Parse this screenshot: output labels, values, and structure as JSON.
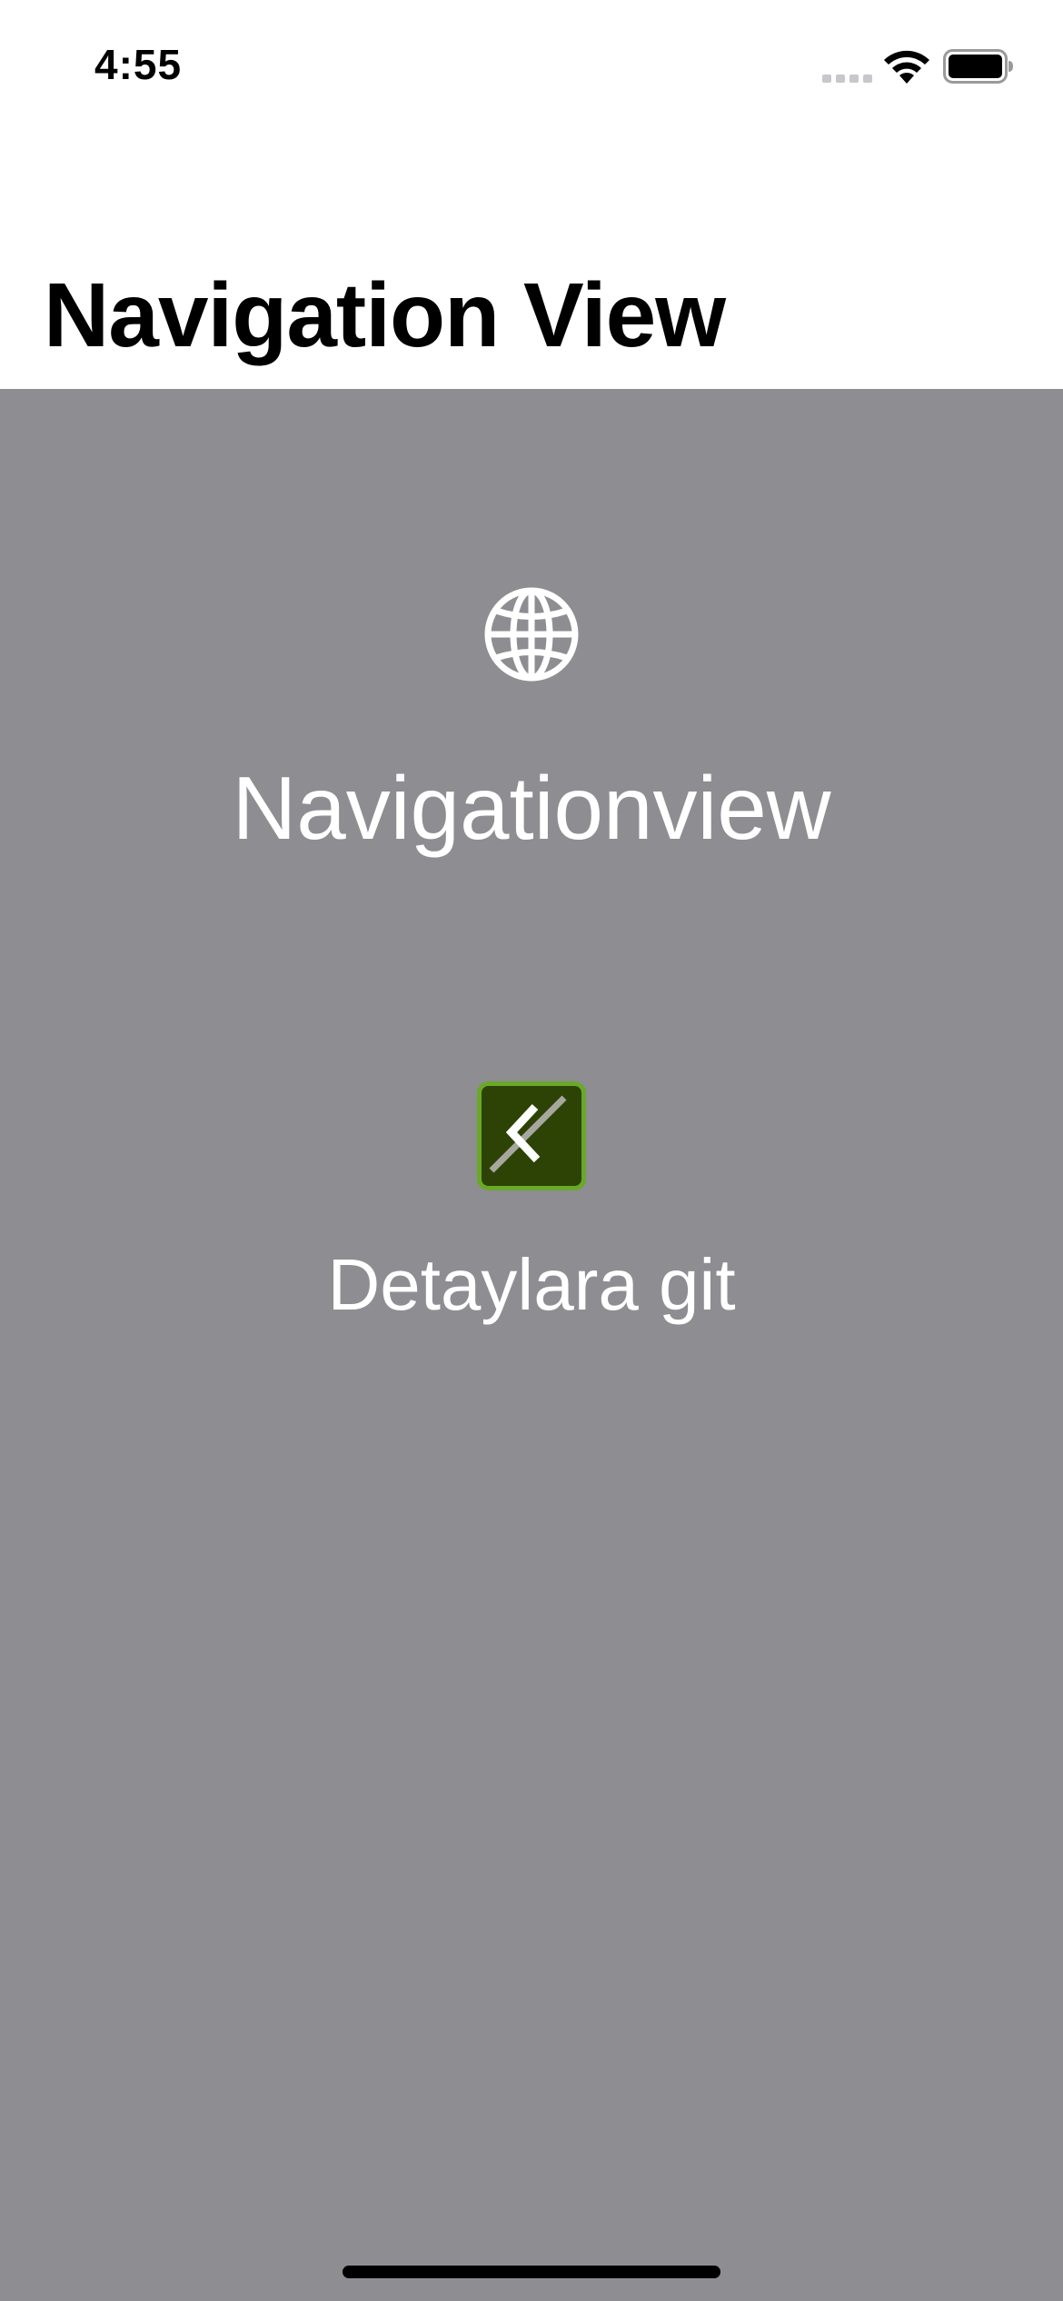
{
  "status_bar": {
    "time": "4:55"
  },
  "nav": {
    "title": "Navigation View"
  },
  "content": {
    "headline": "Navigationview",
    "link_label": "Detaylara git",
    "icons": {
      "top": "globe-icon",
      "link_image": "broken-image-icon"
    }
  },
  "colors": {
    "content_background": "#8e8d92",
    "text_on_content": "#ffffff",
    "link_image_background": "#2d4306",
    "link_image_border": "#6aa82a"
  }
}
